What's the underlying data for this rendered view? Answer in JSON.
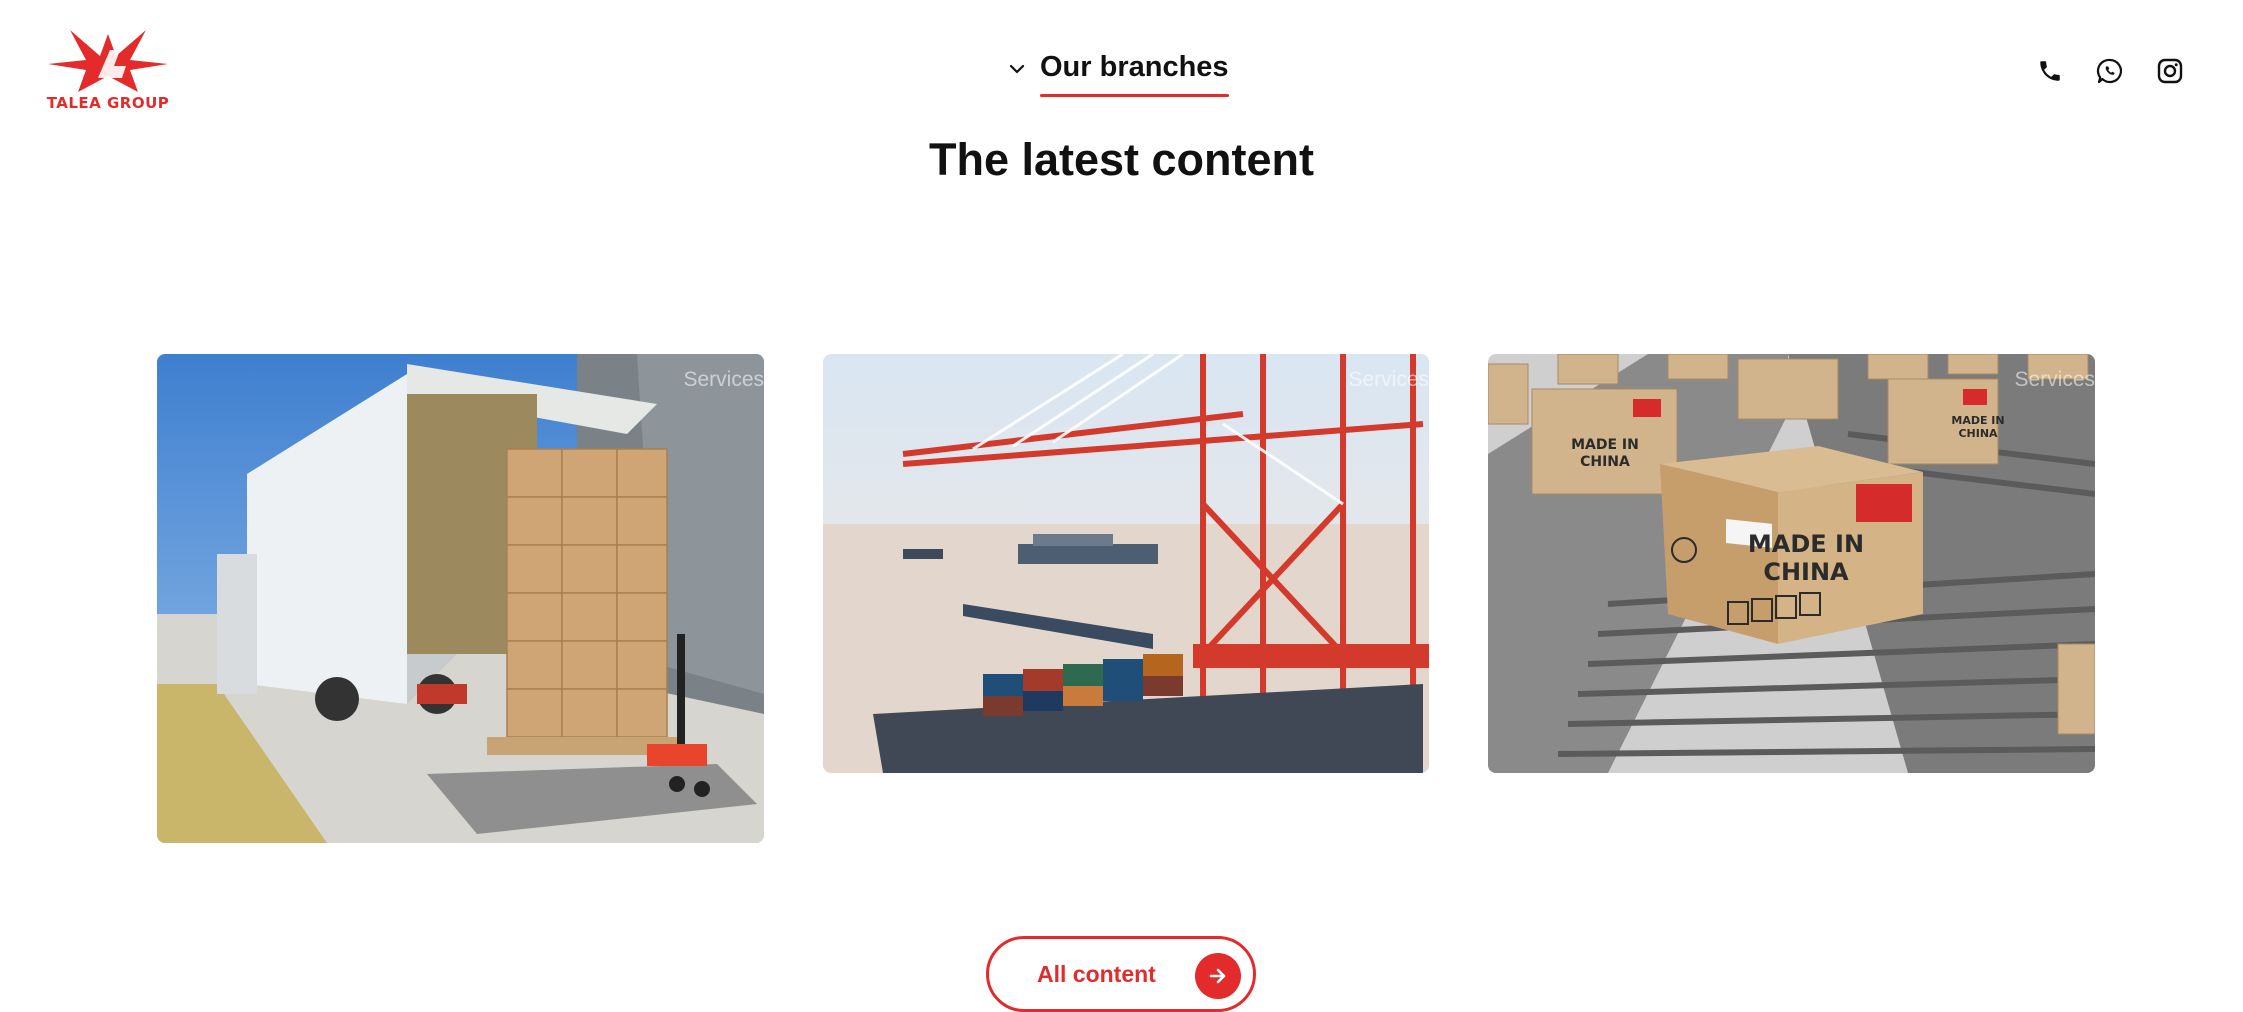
{
  "brand": {
    "logo_text": "TALEA GROUP",
    "accent_color": "#e32b2b"
  },
  "nav": {
    "branches_label": "Our branches",
    "chevron_icon": "chevron-down-icon"
  },
  "header_icons": [
    "phone-icon",
    "whatsapp-icon",
    "instagram-icon"
  ],
  "section": {
    "title": "The latest content"
  },
  "cards": [
    {
      "tag": "Services",
      "image": "truck-loading-pallet-image"
    },
    {
      "tag": "Services",
      "image": "container-port-cranes-image"
    },
    {
      "tag": "Services",
      "image": "made-in-china-conveyor-image"
    }
  ],
  "cta": {
    "label": "All content",
    "icon": "arrow-right-icon"
  }
}
